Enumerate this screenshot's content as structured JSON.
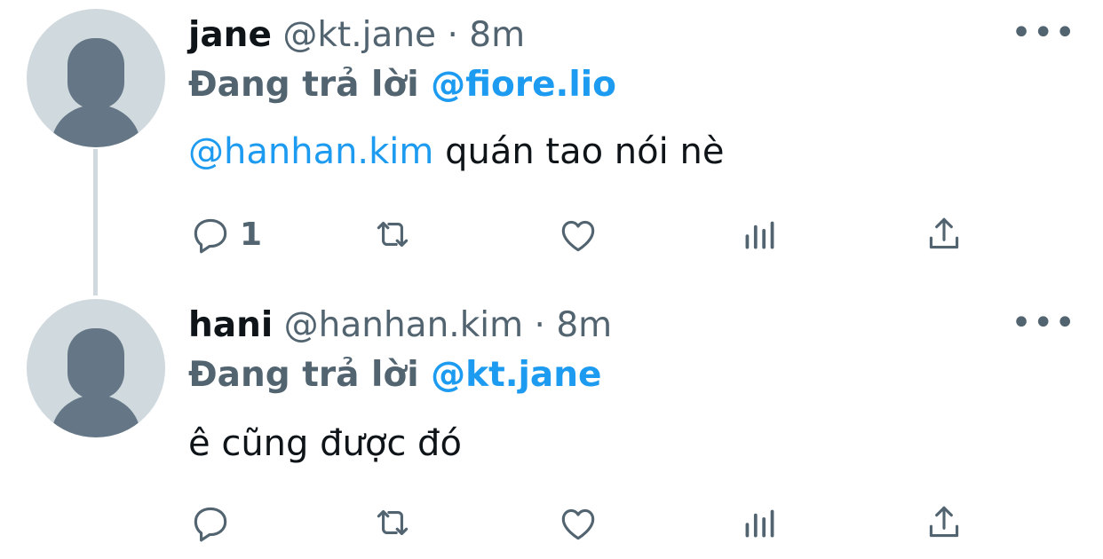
{
  "tweets": [
    {
      "name": "jane",
      "handle": "@kt.jane",
      "separator": "·",
      "time": "8m",
      "reply_prefix": "Đang trả lời",
      "reply_to": "@fiore.lio",
      "mention": "@hanhan.kim",
      "text": " quán tao nói nè",
      "reply_count": "1",
      "more_label": "•••"
    },
    {
      "name": "hani",
      "handle": "@hanhan.kim",
      "separator": "·",
      "time": "8m",
      "reply_prefix": "Đang trả lời",
      "reply_to": "@kt.jane",
      "mention": "",
      "text": "ê cũng được đó",
      "reply_count": "",
      "more_label": "•••"
    }
  ],
  "icons": [
    "reply-icon",
    "retweet-icon",
    "like-icon",
    "views-icon",
    "share-icon"
  ],
  "colors": {
    "accent": "#1d9bf0",
    "muted": "#536471",
    "text": "#0f1419",
    "avatar_bg": "#cfd9de"
  }
}
